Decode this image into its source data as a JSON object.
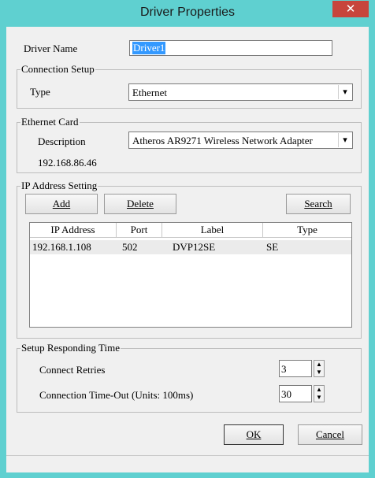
{
  "window": {
    "title": "Driver Properties",
    "close_glyph": "✕"
  },
  "driver_name": {
    "label": "Driver Name",
    "value": "Driver1"
  },
  "connection_setup": {
    "caption": "Connection Setup",
    "type_label": "Type",
    "type_value": "Ethernet"
  },
  "ethernet_card": {
    "caption": "Ethernet Card",
    "description_label": "Description",
    "description_value": "Atheros AR9271 Wireless Network Adapter",
    "ip": "192.168.86.46"
  },
  "ip_setting": {
    "caption": "IP Address Setting",
    "add_label": "Add",
    "delete_label": "Delete",
    "search_label": "Search",
    "columns": [
      "IP Address",
      "Port",
      "Label",
      "Type"
    ],
    "rows": [
      {
        "ip": "192.168.1.108",
        "port": "502",
        "label": "DVP12SE",
        "type": "SE"
      }
    ]
  },
  "responding": {
    "caption": "Setup Responding Time",
    "retries_label": "Connect Retries",
    "retries_value": "3",
    "timeout_label": "Connection Time-Out (Units: 100ms)",
    "timeout_value": "30"
  },
  "buttons": {
    "ok": "OK",
    "cancel": "Cancel"
  },
  "icons": {
    "dropdown": "▾",
    "spin_up": "▲",
    "spin_down": "▼"
  }
}
